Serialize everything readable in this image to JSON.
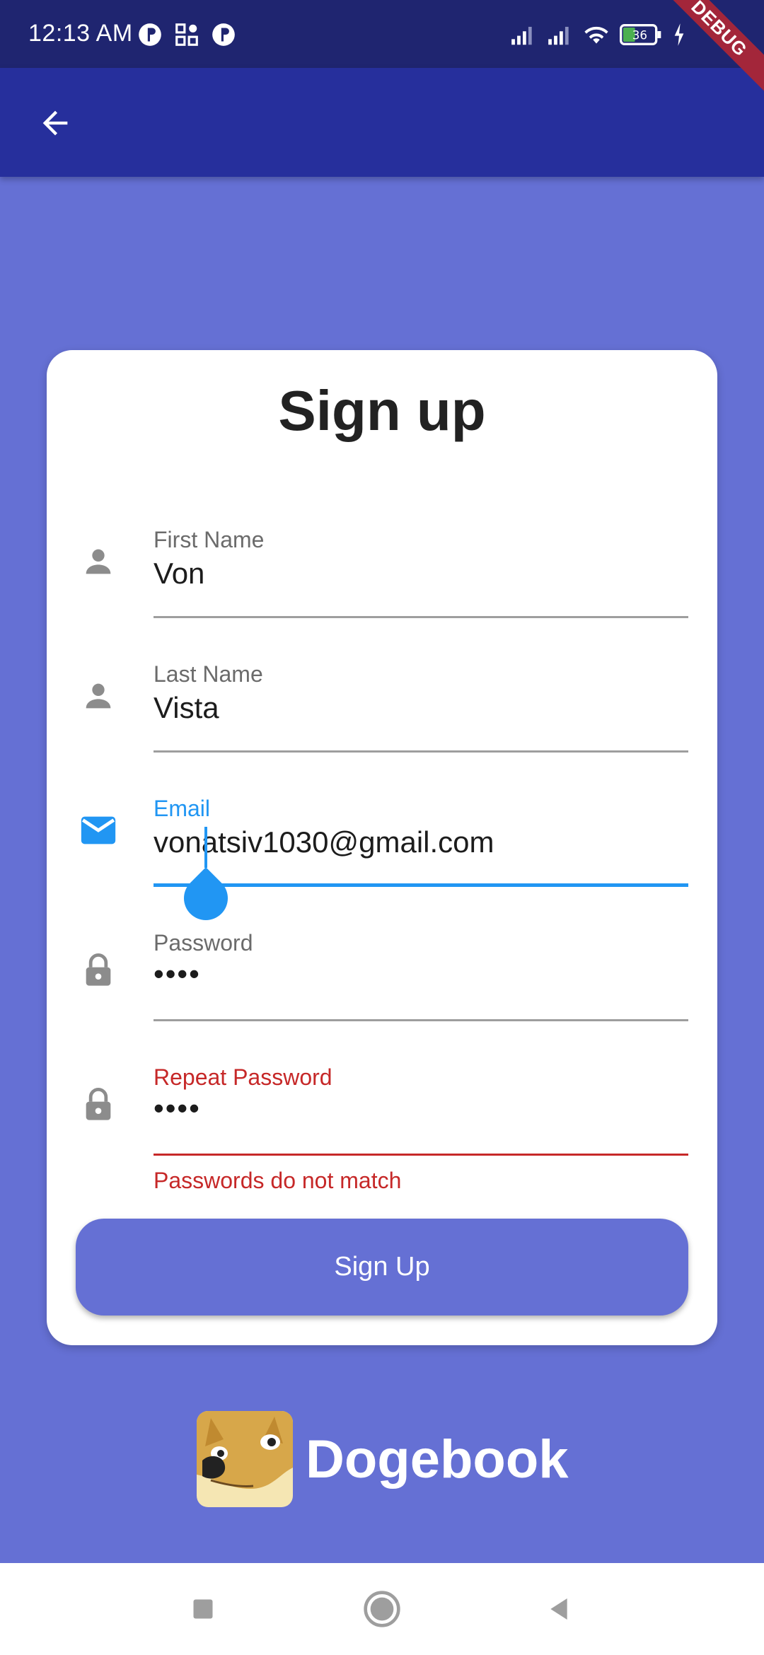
{
  "status_bar": {
    "time": "12:13 AM",
    "battery": "36",
    "debug_label": "DEBUG",
    "icons": [
      "notification-icon",
      "grid-icon",
      "notification-icon",
      "signal-icon",
      "signal-icon",
      "wifi-icon",
      "battery-icon",
      "charging-icon"
    ]
  },
  "app_bar": {
    "back_icon": "arrow-back-icon"
  },
  "form": {
    "title": "Sign up",
    "first_name": {
      "label": "First Name",
      "value": "Von",
      "icon": "person-icon"
    },
    "last_name": {
      "label": "Last Name",
      "value": "Vista",
      "icon": "person-icon"
    },
    "email": {
      "label": "Email",
      "value": "vonatsiv1030@gmail.com",
      "icon": "mail-icon"
    },
    "password": {
      "label": "Password",
      "value": "••••",
      "icon": "lock-icon"
    },
    "repeat_password": {
      "label": "Repeat Password",
      "value": "••••",
      "icon": "lock-icon",
      "error": "Passwords do not match"
    },
    "submit_label": "Sign Up"
  },
  "brand": {
    "name": "Dogebook"
  },
  "colors": {
    "background": "#6570d4",
    "app_bar": "#262f9c",
    "status_bar": "#1f2570",
    "focus": "#2196f3",
    "error": "#c62828"
  }
}
